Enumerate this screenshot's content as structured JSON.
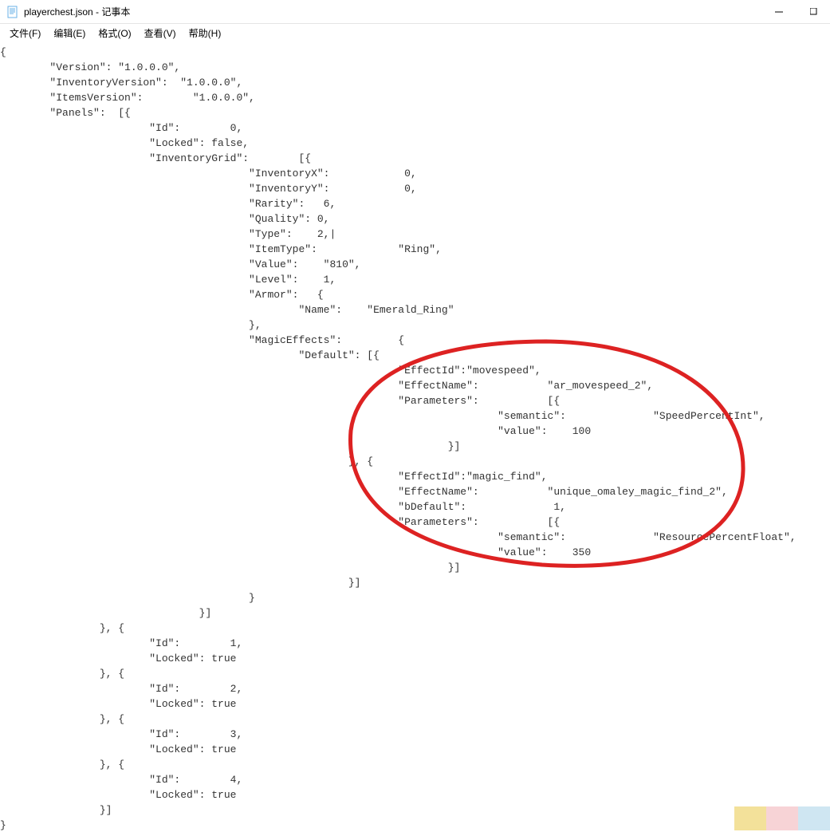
{
  "title": "playerchest.json - 记事本",
  "menus": {
    "file": "文件(F)",
    "edit": "编辑(E)",
    "format": "格式(O)",
    "view": "查看(V)",
    "help": "帮助(H)"
  },
  "json_text": "{\n        \"Version\": \"1.0.0.0\",\n        \"InventoryVersion\":  \"1.0.0.0\",\n        \"ItemsVersion\":        \"1.0.0.0\",\n        \"Panels\":  [{\n                        \"Id\":        0,\n                        \"Locked\": false,\n                        \"InventoryGrid\":        [{\n                                        \"InventoryX\":            0,\n                                        \"InventoryY\":            0,\n                                        \"Rarity\":   6,\n                                        \"Quality\": 0,\n                                        \"Type\":    2,|\n                                        \"ItemType\":             \"Ring\",\n                                        \"Value\":    \"810\",\n                                        \"Level\":    1,\n                                        \"Armor\":   {\n                                                \"Name\":    \"Emerald_Ring\"\n                                        },\n                                        \"MagicEffects\":         {\n                                                \"Default\": [{\n                                                                \"EffectId\":\"movespeed\",\n                                                                \"EffectName\":           \"ar_movespeed_2\",\n                                                                \"Parameters\":           [{\n                                                                                \"semantic\":              \"SpeedPercentInt\",\n                                                                                \"value\":    100\n                                                                        }]\n                                                        }, {\n                                                                \"EffectId\":\"magic_find\",\n                                                                \"EffectName\":           \"unique_omaley_magic_find_2\",\n                                                                \"bDefault\":              1,\n                                                                \"Parameters\":           [{\n                                                                                \"semantic\":              \"ResourcePercentFloat\",\n                                                                                \"value\":    350\n                                                                        }]\n                                                        }]\n                                        }\n                                }]\n                }, {\n                        \"Id\":        1,\n                        \"Locked\": true\n                }, {\n                        \"Id\":        2,\n                        \"Locked\": true\n                }, {\n                        \"Id\":        3,\n                        \"Locked\": true\n                }, {\n                        \"Id\":        4,\n                        \"Locked\": true\n                }]\n}"
}
